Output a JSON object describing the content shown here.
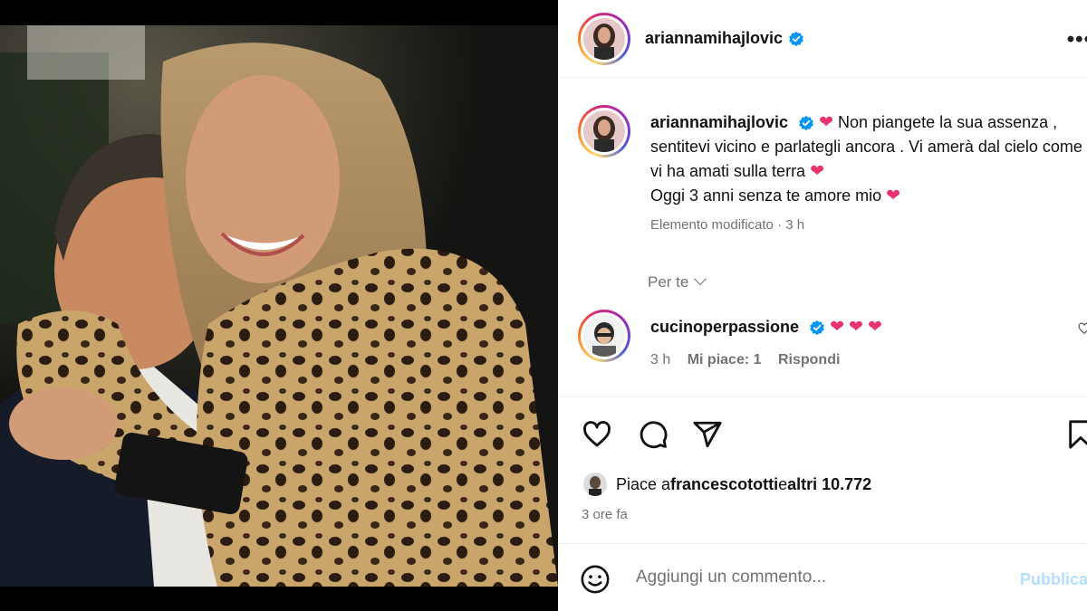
{
  "post": {
    "username": "ariannamihajlovic",
    "more_icon": "more-horizontal-icon"
  },
  "caption": {
    "username": "ariannamihajlovic",
    "text_1": " Non piangete la sua assenza , sentitevi vicino e parlategli ancora . Vi amerà dal cielo come vi ha amati sulla terra ",
    "text_2": "Oggi 3 anni senza te amore mio ",
    "heart": "❤",
    "meta": "Elemento modificato · 3 h"
  },
  "comments_filter": {
    "label": "Per te"
  },
  "comment": {
    "username": "cucinoperpassione",
    "hearts": [
      "❤",
      "❤",
      "❤"
    ],
    "time": "3 h",
    "likes": "Mi piace: 1",
    "reply": "Rispondi"
  },
  "actions": [
    "heart-icon",
    "comment-icon",
    "share-icon",
    "bookmark-icon"
  ],
  "likes": {
    "prefix": "Piace a ",
    "user": "francescototti",
    "middle": " e ",
    "others": "altri 10.772"
  },
  "posted": "3 ore fa",
  "add_comment": {
    "placeholder": "Aggiungi un commento...",
    "publish": "Pubblica"
  },
  "colors": {
    "verified": "#0095f6",
    "heart": "#e8336d",
    "muted": "#737373",
    "publish": "#b2dffc"
  }
}
